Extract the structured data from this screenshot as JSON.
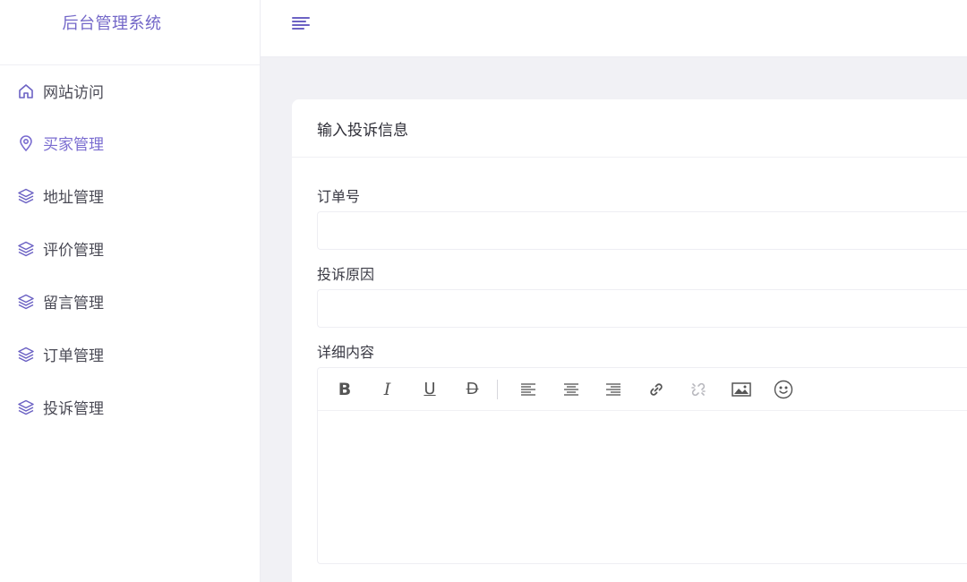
{
  "sidebar": {
    "title": "后台管理系统",
    "items": [
      {
        "label": "网站访问",
        "icon": "home-icon",
        "active": false
      },
      {
        "label": "买家管理",
        "icon": "location-pin-icon",
        "active": true
      },
      {
        "label": "地址管理",
        "icon": "layers-icon",
        "active": false
      },
      {
        "label": "评价管理",
        "icon": "layers-icon",
        "active": false
      },
      {
        "label": "留言管理",
        "icon": "layers-icon",
        "active": false
      },
      {
        "label": "订单管理",
        "icon": "layers-icon",
        "active": false
      },
      {
        "label": "投诉管理",
        "icon": "layers-icon",
        "active": false
      }
    ]
  },
  "header": {
    "menu_icon": "hamburger-menu-icon"
  },
  "form": {
    "title": "输入投诉信息",
    "order_label": "订单号",
    "order_value": "",
    "reason_label": "投诉原因",
    "reason_value": "",
    "detail_label": "详细内容",
    "toolbar": {
      "bold": "B",
      "italic": "I",
      "underline": "U",
      "strikethrough": "D",
      "tools": [
        "align-left-icon",
        "align-center-icon",
        "align-right-icon",
        "link-icon",
        "unlink-icon",
        "image-icon",
        "emoji-icon"
      ]
    }
  },
  "colors": {
    "accent": "#7a6cd0",
    "brand": "#7367c8",
    "background": "#f1f1f5"
  }
}
